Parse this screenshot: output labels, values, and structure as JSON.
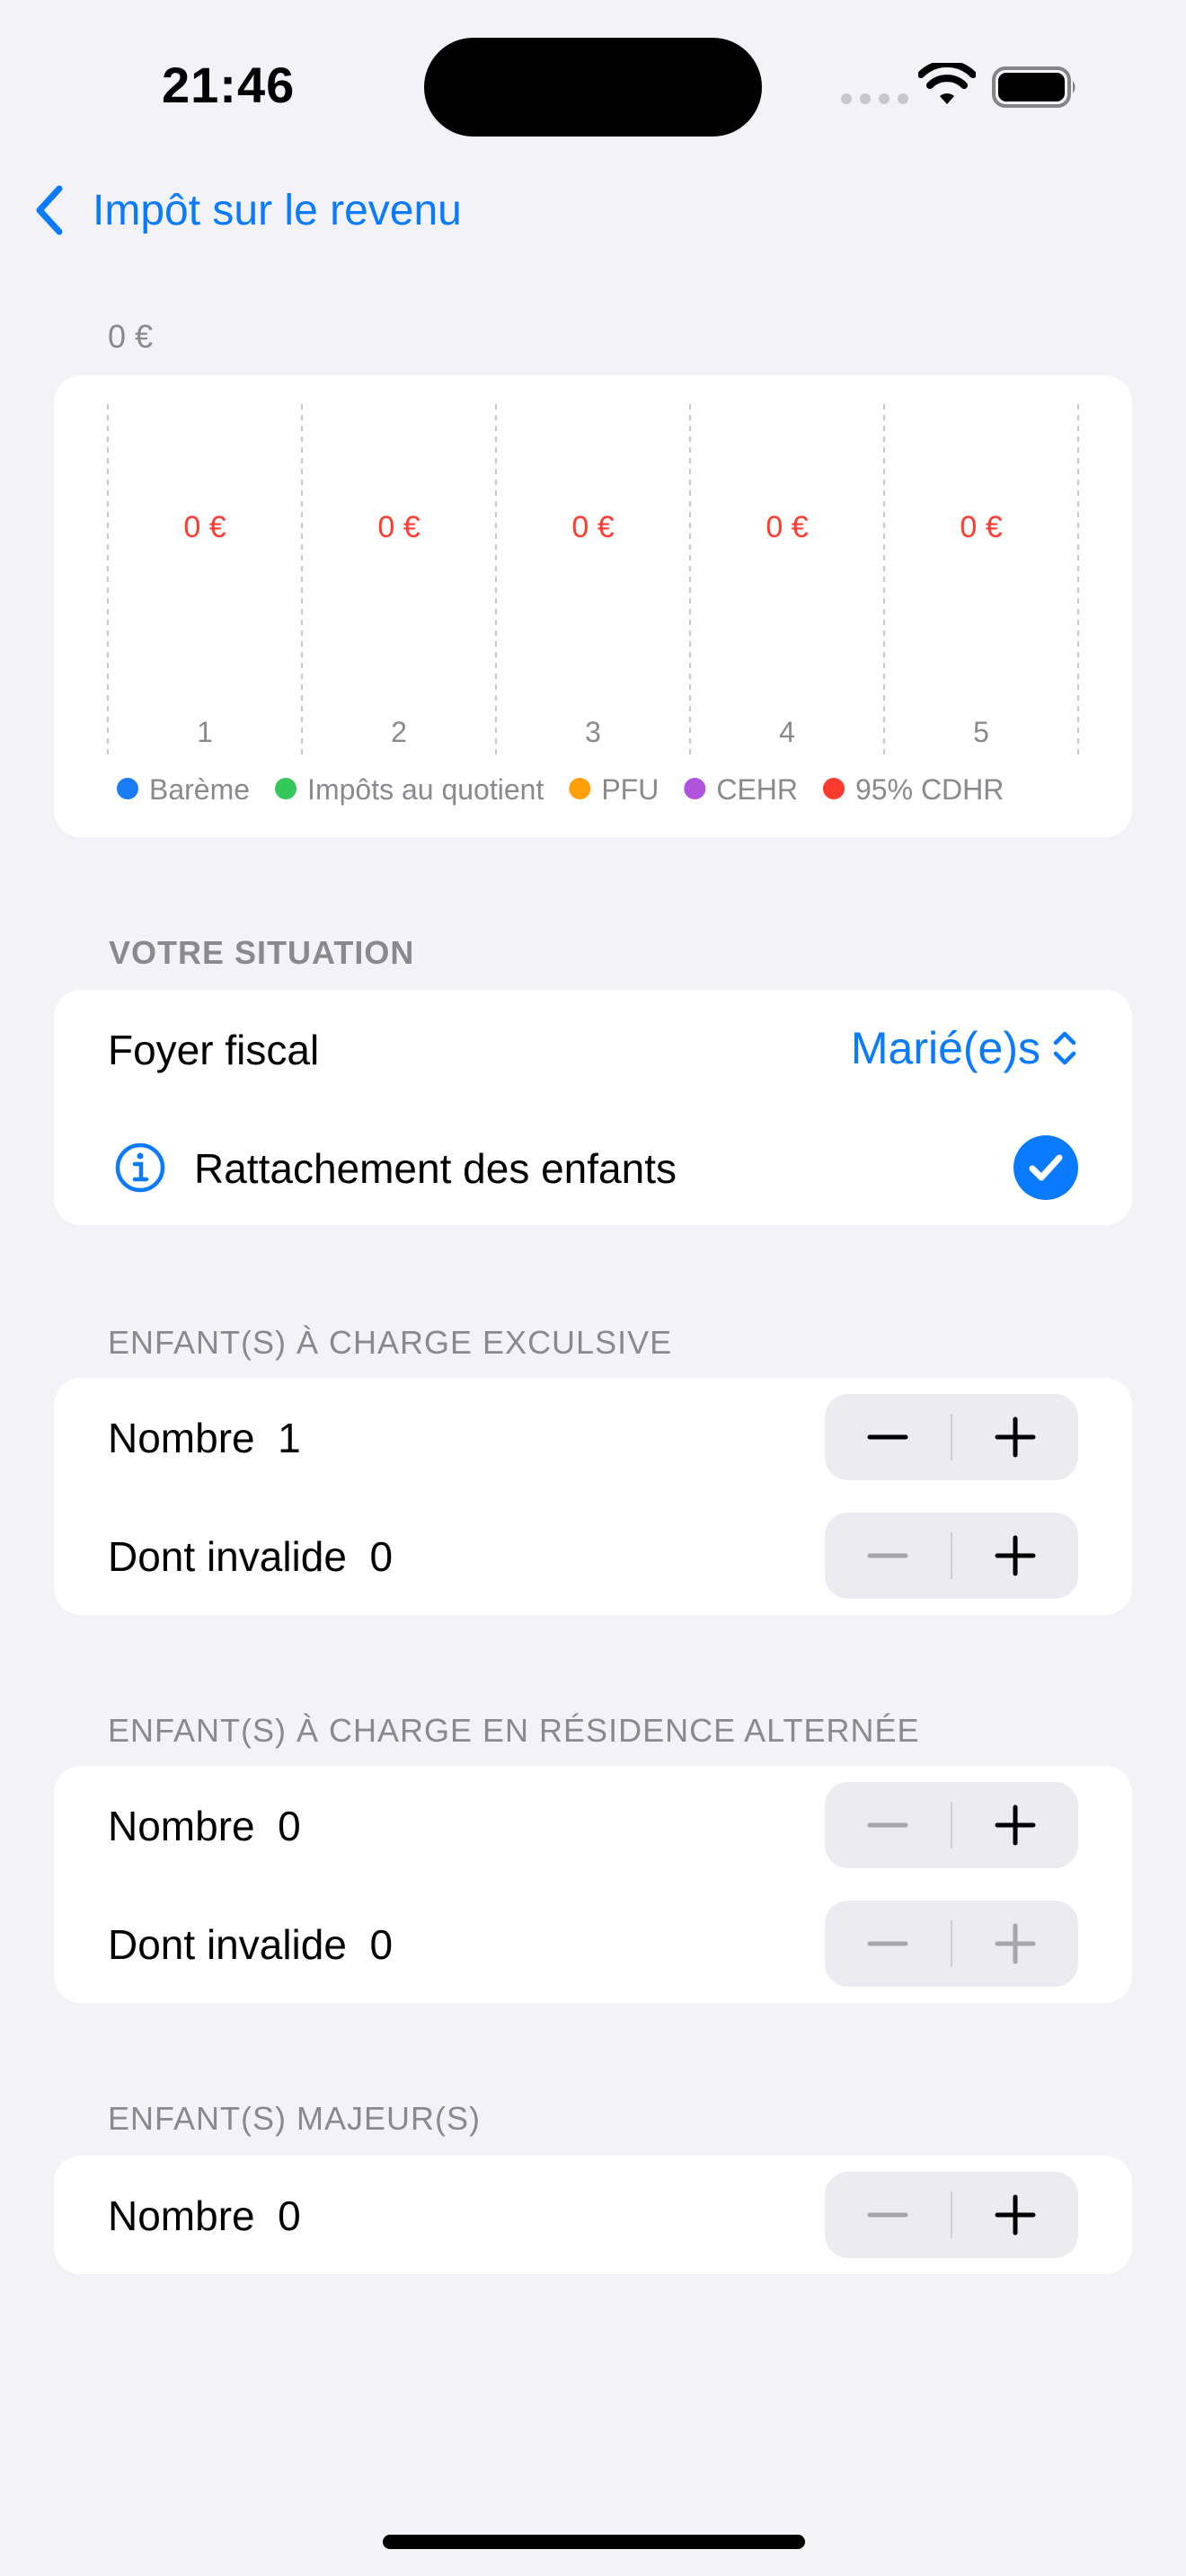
{
  "status_bar": {
    "time": "21:46"
  },
  "nav": {
    "back_label": "Impôt sur le revenu"
  },
  "chart_data": {
    "type": "bar",
    "title": "",
    "top_label": "0 €",
    "categories": [
      "1",
      "2",
      "3",
      "4",
      "5"
    ],
    "value_labels": [
      "0 €",
      "0 €",
      "0 €",
      "0 €",
      "0 €"
    ],
    "series": [
      {
        "name": "Barème",
        "values": [
          0,
          0,
          0,
          0,
          0
        ],
        "color": "#1a7cf5"
      },
      {
        "name": "Impôts au quotient",
        "values": [
          0,
          0,
          0,
          0,
          0
        ],
        "color": "#34c759"
      },
      {
        "name": "PFU",
        "values": [
          0,
          0,
          0,
          0,
          0
        ],
        "color": "#ff9f0a"
      },
      {
        "name": "CEHR",
        "values": [
          0,
          0,
          0,
          0,
          0
        ],
        "color": "#af52de"
      },
      {
        "name": "95% CDHR",
        "values": [
          0,
          0,
          0,
          0,
          0
        ],
        "color": "#ff3b30"
      }
    ],
    "value_label_color": "#ff3b30",
    "grid": true,
    "legend": "bottom"
  },
  "situation": {
    "header": "VOTRE SITUATION",
    "foyer_label": "Foyer fiscal",
    "foyer_value": "Marié(e)s",
    "rattachement_label": "Rattachement des enfants",
    "rattachement_checked": true
  },
  "exclusive": {
    "header": "ENFANT(S) À CHARGE EXCULSIVE",
    "rows": [
      {
        "label": "Nombre",
        "value": "1",
        "minus_enabled": true,
        "plus_enabled": true
      },
      {
        "label": "Dont invalide",
        "value": "0",
        "minus_enabled": false,
        "plus_enabled": true
      }
    ]
  },
  "alternee": {
    "header": "ENFANT(S) À CHARGE EN RÉSIDENCE ALTERNÉE",
    "rows": [
      {
        "label": "Nombre",
        "value": "0",
        "minus_enabled": false,
        "plus_enabled": true
      },
      {
        "label": "Dont invalide",
        "value": "0",
        "minus_enabled": false,
        "plus_enabled": false
      }
    ]
  },
  "majeurs": {
    "header": "ENFANT(S) MAJEUR(S)",
    "rows": [
      {
        "label": "Nombre",
        "value": "0",
        "minus_enabled": false,
        "plus_enabled": true
      }
    ]
  },
  "colors": {
    "accent": "#0a7aff",
    "background": "#f2f2f7",
    "secondary_text": "#8a8a8e"
  }
}
